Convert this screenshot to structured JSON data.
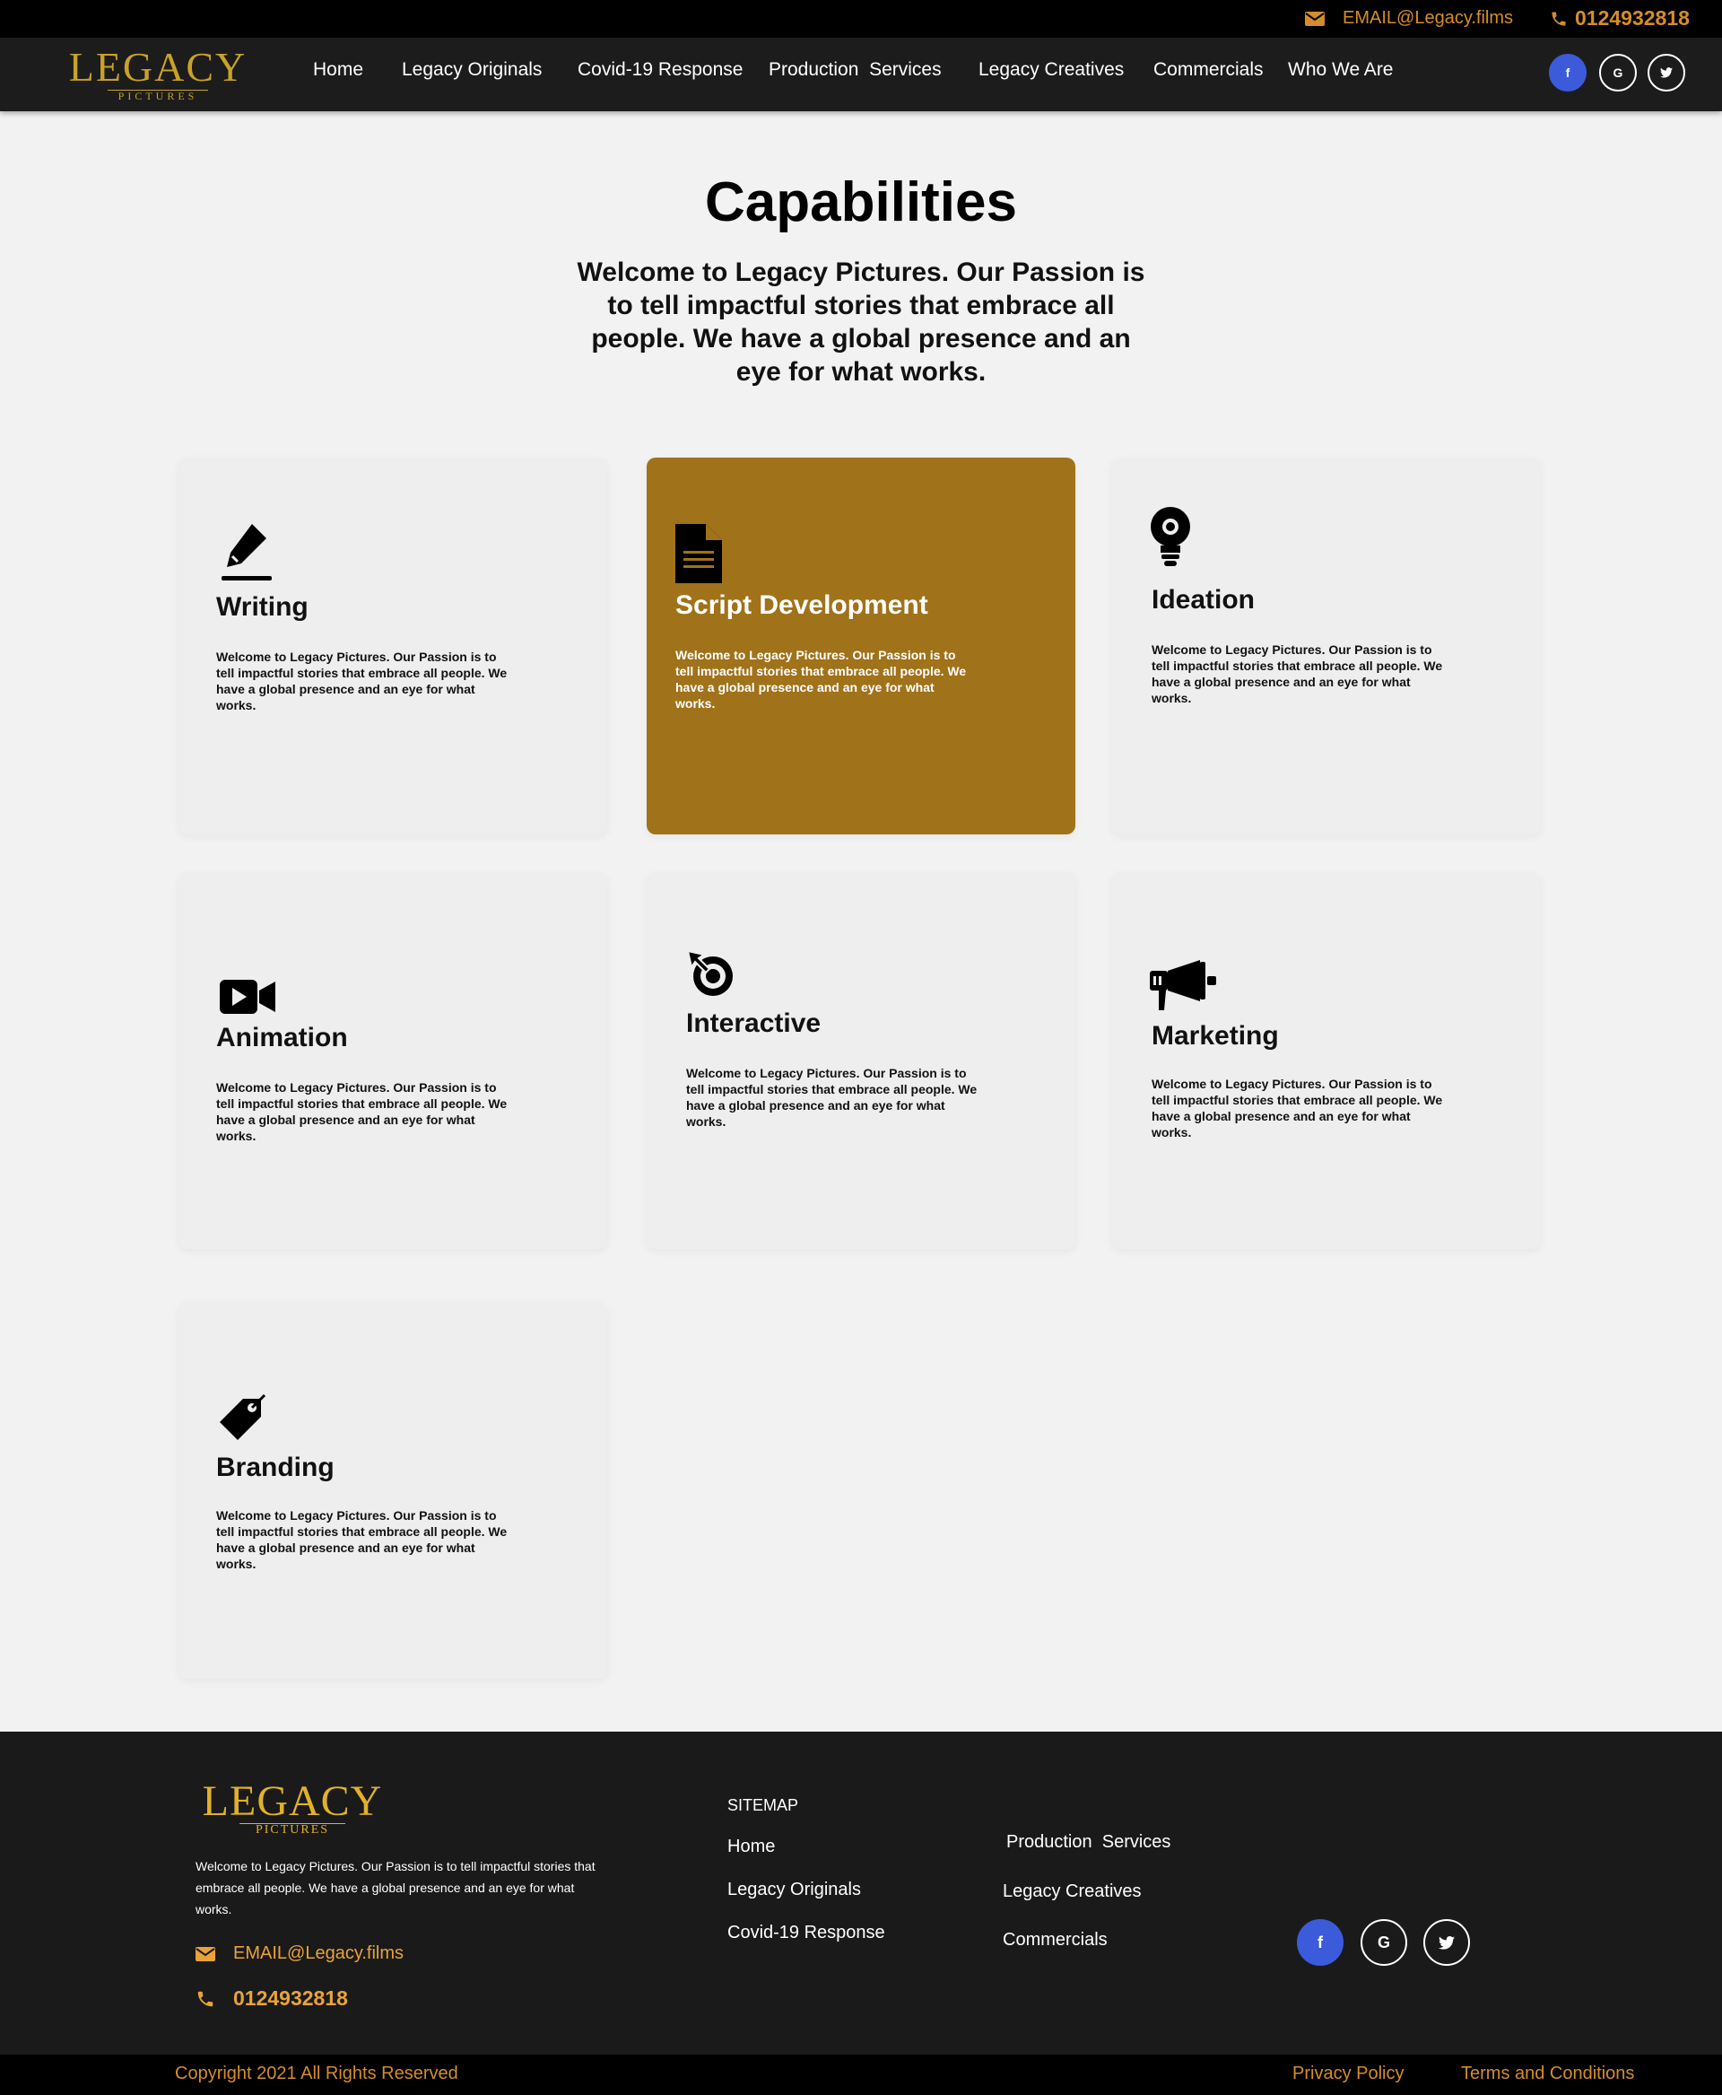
{
  "topbar": {
    "email": "EMAIL@Legacy.films",
    "phone": "0124932818"
  },
  "brand": {
    "logo_main": "LEGACY",
    "logo_sub": "PICTURES"
  },
  "nav": {
    "items": [
      {
        "label": "Home"
      },
      {
        "label": "Legacy Originals"
      },
      {
        "label": "Covid-19 Response"
      },
      {
        "label": "Production  Services"
      },
      {
        "label": "Legacy Creatives"
      },
      {
        "label": "Commercials"
      },
      {
        "label": "Who We Are"
      }
    ],
    "social": [
      {
        "label": "f",
        "icon": "facebook-icon"
      },
      {
        "label": "G",
        "icon": "google-icon"
      },
      {
        "label": "t",
        "icon": "twitter-icon"
      }
    ]
  },
  "hero": {
    "title": "Capabilities",
    "text": "Welcome to Legacy Pictures. Our Passion is to tell impactful stories that embrace all people. We have a global presence and an eye for what works."
  },
  "cards": [
    {
      "title": "Writing",
      "icon": "pen-icon",
      "desc": "Welcome to Legacy Pictures. Our Passion is to tell impactful stories that embrace all people. We have a global presence and an eye for what works."
    },
    {
      "title": "Script Development",
      "icon": "document-icon",
      "desc": "Welcome to Legacy Pictures. Our Passion is to tell impactful stories that embrace all people. We have a global presence and an eye for what works."
    },
    {
      "title": "Ideation",
      "icon": "lightbulb-icon",
      "desc": "Welcome to Legacy Pictures. Our Passion is to tell impactful stories that embrace all people. We have a global presence and an eye for what works."
    },
    {
      "title": "Animation",
      "icon": "video-camera-icon",
      "desc": "Welcome to Legacy Pictures. Our Passion is to tell impactful stories that embrace all people. We have a global presence and an eye for what works."
    },
    {
      "title": "Interactive",
      "icon": "cursor-click-icon",
      "desc": "Welcome to Legacy Pictures. Our Passion is to tell impactful stories that embrace all people. We have a global presence and an eye for what works."
    },
    {
      "title": "Marketing",
      "icon": "megaphone-icon",
      "desc": "Welcome to Legacy Pictures. Our Passion is to tell impactful stories that embrace all people. We have a global presence and an eye for what works."
    },
    {
      "title": "Branding",
      "icon": "tag-icon",
      "desc": "Welcome to Legacy Pictures. Our Passion is to tell impactful stories that embrace all people. We have a global presence and an eye for what works."
    }
  ],
  "footer": {
    "logo_main": "LEGACY",
    "logo_sub": "PICTURES",
    "about": "Welcome to Legacy Pictures. Our Passion is to tell impactful stories that embrace all people. We have a global presence and an eye for what works.",
    "email": "EMAIL@Legacy.films",
    "phone": "0124932818",
    "sitemap_heading": "SITEMAP",
    "links": [
      {
        "label": "Home"
      },
      {
        "label": "Legacy Originals"
      },
      {
        "label": "Covid-19 Response"
      },
      {
        "label": "Production  Services"
      },
      {
        "label": "Legacy Creatives"
      },
      {
        "label": "Commercials"
      }
    ]
  },
  "copyright": {
    "text": "Copyright 2021 All Rights Reserved",
    "privacy": "Privacy Policy",
    "terms": "Terms and Conditions"
  },
  "colors": {
    "accent": "#a0721a",
    "gold": "#c9a227",
    "orange": "#d48d2c",
    "facebook": "#3b5bdb",
    "nav_bg": "#1c1c1c"
  }
}
